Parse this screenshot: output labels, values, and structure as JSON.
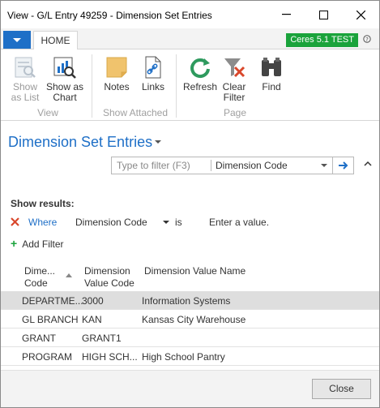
{
  "window": {
    "title": "View - G/L Entry 49259 - Dimension Set Entries",
    "minimize_glyph": "–",
    "maximize_glyph": "☐",
    "close_glyph": "✕"
  },
  "ribbon": {
    "tab": "HOME",
    "environment_badge": "Ceres 5.1 TEST",
    "badge_color": "#1aa33b",
    "accent_color": "#1e6fc7",
    "groups": [
      {
        "label": "View",
        "buttons": [
          {
            "label_1": "Show",
            "label_2": "as List",
            "icon": "list-view-icon",
            "enabled": false
          },
          {
            "label_1": "Show as",
            "label_2": "Chart",
            "icon": "chart-view-icon",
            "enabled": true
          }
        ]
      },
      {
        "label": "Show Attached",
        "buttons": [
          {
            "label_1": "Notes",
            "label_2": "",
            "icon": "notes-icon",
            "enabled": true
          },
          {
            "label_1": "Links",
            "label_2": "",
            "icon": "links-icon",
            "enabled": true
          }
        ]
      },
      {
        "label": "Page",
        "buttons": [
          {
            "label_1": "Refresh",
            "label_2": "",
            "icon": "refresh-icon",
            "enabled": true
          },
          {
            "label_1": "Clear",
            "label_2": "Filter",
            "icon": "clear-filter-icon",
            "enabled": true
          },
          {
            "label_1": "Find",
            "label_2": "",
            "icon": "binoculars-icon",
            "enabled": true
          }
        ]
      }
    ]
  },
  "page": {
    "title": "Dimension Set Entries",
    "filter": {
      "placeholder": "Type to filter (F3)",
      "field": "Dimension Code"
    },
    "show_results_label": "Show results:",
    "where": {
      "label": "Where",
      "field": "Dimension Code",
      "operator": "is",
      "value_placeholder": "Enter a value."
    },
    "add_filter_label": "Add Filter"
  },
  "grid": {
    "columns": [
      {
        "line1": "Dime...",
        "line2": "Code"
      },
      {
        "line1": "Dimension",
        "line2": "Value Code"
      },
      {
        "line1": "Dimension Value Name",
        "line2": ""
      }
    ],
    "rows": [
      {
        "code": "DEPARTME...",
        "value_code": "3000",
        "value_name": "Information Systems",
        "selected": true
      },
      {
        "code": "GL BRANCH",
        "value_code": "KAN",
        "value_name": "Kansas City Warehouse",
        "selected": false
      },
      {
        "code": "GRANT",
        "value_code": "GRANT1",
        "value_name": "",
        "selected": false
      },
      {
        "code": "PROGRAM",
        "value_code": "HIGH SCH...",
        "value_name": "High School Pantry",
        "selected": false
      }
    ]
  },
  "footer": {
    "close_label": "Close"
  }
}
